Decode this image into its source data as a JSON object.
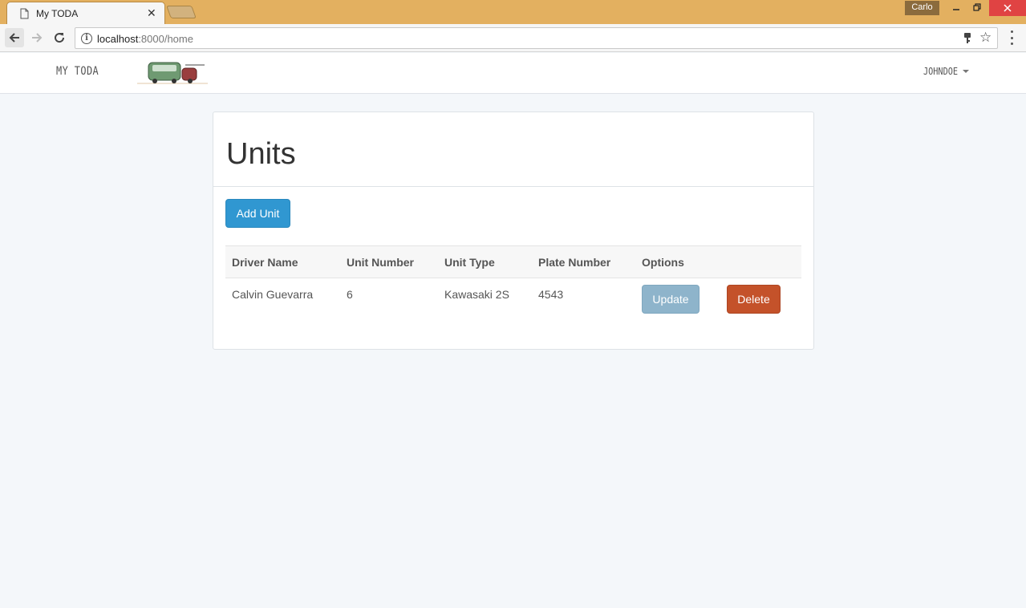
{
  "browser": {
    "tab_title": "My TODA",
    "tab_close": "✕",
    "profile_name": "Carlo",
    "url_host": "localhost",
    "url_path": ":8000/home",
    "icons": [
      "page-icon",
      "back-arrow-icon",
      "forward-arrow-icon",
      "reload-icon",
      "info-icon",
      "key-icon",
      "star-icon",
      "menu-icon"
    ]
  },
  "navbar": {
    "brand": "MY TODA",
    "user_name": "JOHNDOE"
  },
  "panel": {
    "title": "Units",
    "add_button": "Add Unit"
  },
  "table": {
    "headers": [
      "Driver Name",
      "Unit Number",
      "Unit Type",
      "Plate Number",
      "Options"
    ],
    "rows": [
      {
        "driver_name": "Calvin Guevarra",
        "unit_number": "6",
        "unit_type": "Kawasaki 2S",
        "plate_number": "4543",
        "update_label": "Update",
        "delete_label": "Delete"
      }
    ]
  },
  "colors": {
    "primary": "#3097d1",
    "update": "#8eb4cb",
    "danger": "#c4522a",
    "titlebar": "#e3b060",
    "page_bg": "#f4f7fa"
  }
}
